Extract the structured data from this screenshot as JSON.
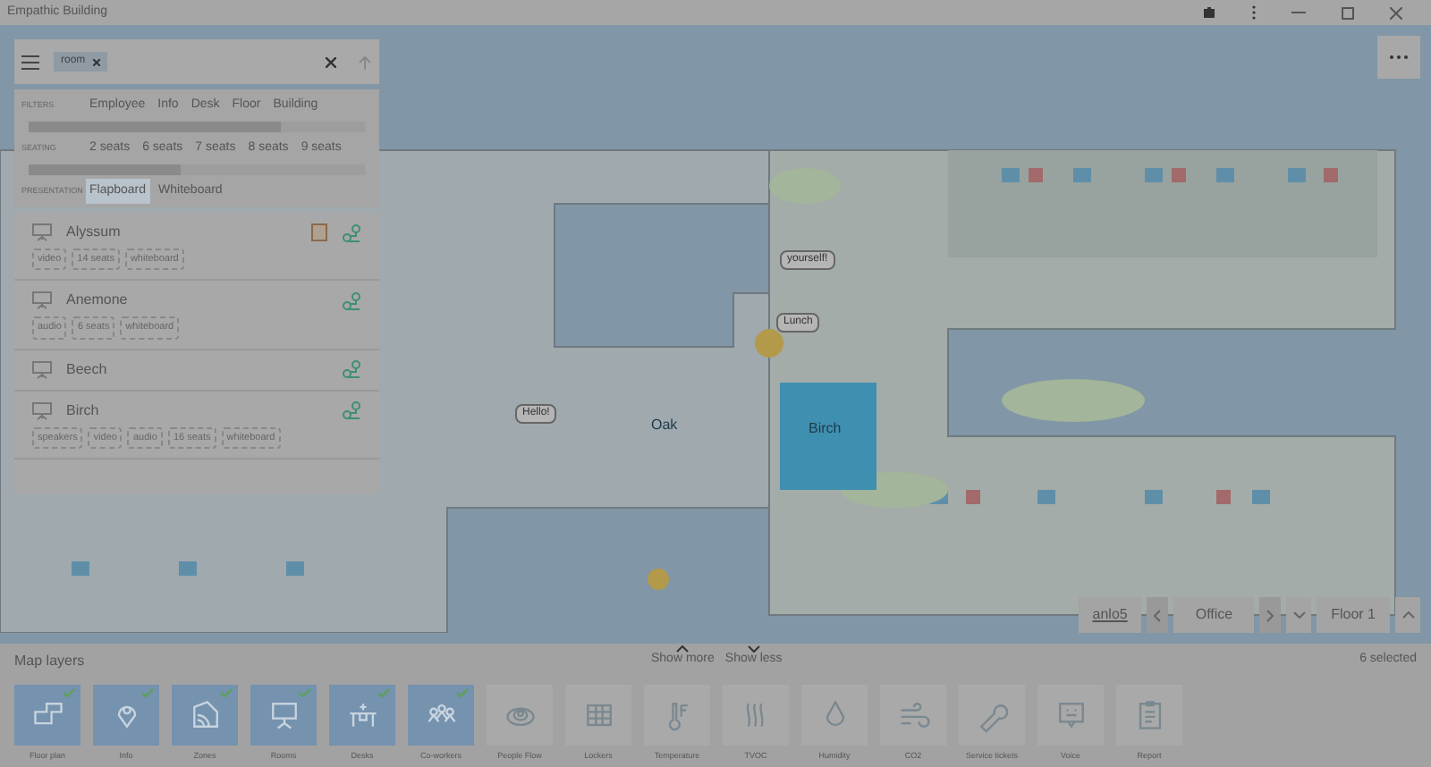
{
  "window": {
    "title": "Empathic Building"
  },
  "search": {
    "chips": [
      "room"
    ]
  },
  "filters": [
    {
      "label": "FILTERS",
      "options": [
        {
          "text": "Employee",
          "selected": false
        },
        {
          "text": "Info",
          "selected": false
        },
        {
          "text": "Desk",
          "selected": false
        },
        {
          "text": "Floor",
          "selected": false
        },
        {
          "text": "Building",
          "selected": false
        }
      ]
    },
    {
      "label": "SEATING",
      "options": [
        {
          "text": "2 seats",
          "selected": false
        },
        {
          "text": "6 seats",
          "selected": false
        },
        {
          "text": "7 seats",
          "selected": false
        },
        {
          "text": "8 seats",
          "selected": false
        },
        {
          "text": "9 seats",
          "selected": false
        }
      ]
    },
    {
      "label": "PRESENTATION",
      "options": [
        {
          "text": "Flapboard",
          "selected": true
        },
        {
          "text": "Whiteboard",
          "selected": false
        }
      ]
    }
  ],
  "rooms": [
    {
      "name": "Alyssum",
      "booked": true,
      "tags": [
        "video",
        "14 seats",
        "whiteboard"
      ]
    },
    {
      "name": "Anemone",
      "booked": false,
      "tags": [
        "audio",
        "6 seats",
        "whiteboard"
      ]
    },
    {
      "name": "Beech",
      "booked": false
    },
    {
      "name": "Birch",
      "booked": false,
      "tags": [
        "speakers",
        "video",
        "audio",
        "16 seats",
        "whiteboard"
      ]
    }
  ],
  "map_labels": [
    {
      "text": "yourself!",
      "kind": "bubble"
    },
    {
      "text": "Lunch",
      "kind": "bubble"
    },
    {
      "text": "Hello!",
      "kind": "bubble"
    },
    {
      "text": "Birch",
      "kind": "room"
    },
    {
      "text": "Oak",
      "kind": "room"
    }
  ],
  "location": {
    "building": "anlo5",
    "zone": "Office",
    "floor": "Floor 1"
  },
  "layers": {
    "title": "Map layers",
    "show_more": "Show more",
    "show_less": "Show less",
    "count": "6 selected",
    "items": [
      {
        "label": "Floor plan",
        "kind": "floor",
        "checked": true
      },
      {
        "label": "Info",
        "kind": "pin",
        "checked": true
      },
      {
        "label": "Zones",
        "kind": "zones",
        "checked": true
      },
      {
        "label": "Rooms",
        "kind": "board",
        "checked": true
      },
      {
        "label": "Desks",
        "kind": "desk",
        "checked": true
      },
      {
        "label": "Co-workers",
        "kind": "people",
        "checked": true
      },
      {
        "label": "People Flow",
        "kind": "flow",
        "checked": false
      },
      {
        "label": "Lockers",
        "kind": "grid",
        "checked": false
      },
      {
        "label": "Temperature",
        "kind": "temp",
        "checked": false
      },
      {
        "label": "TVOC",
        "kind": "waves",
        "checked": false
      },
      {
        "label": "Humidity",
        "kind": "drop",
        "checked": false
      },
      {
        "label": "CO2",
        "kind": "co2",
        "checked": false
      },
      {
        "label": "Service tickets",
        "kind": "wrench",
        "checked": false
      },
      {
        "label": "Voice",
        "kind": "voice",
        "checked": false
      },
      {
        "label": "Report",
        "kind": "clipboard",
        "checked": false
      }
    ]
  }
}
